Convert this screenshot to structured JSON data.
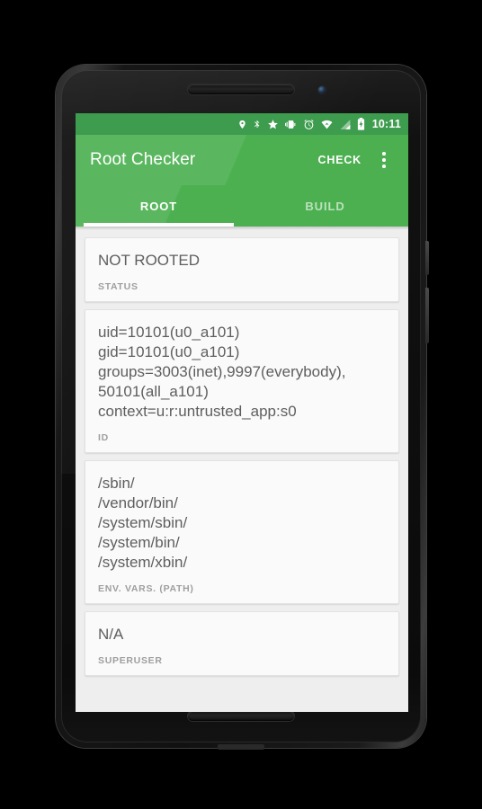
{
  "device": {
    "frame": "android-phone",
    "accent_green": "#4cb050",
    "statusbar_green": "#3d9c4d"
  },
  "statusbar": {
    "icons": [
      "location-icon",
      "bluetooth-icon",
      "star-icon",
      "vibrate-icon",
      "alarm-icon",
      "wifi-icon",
      "signal-icon",
      "battery-charging-icon"
    ],
    "time": "10:11"
  },
  "appbar": {
    "title": "Root Checker",
    "check_label": "CHECK",
    "overflow_label": "More options"
  },
  "tabs": [
    {
      "label": "ROOT",
      "active": true
    },
    {
      "label": "BUILD",
      "active": false
    }
  ],
  "cards": [
    {
      "value": "NOT ROOTED",
      "label": "STATUS"
    },
    {
      "value": "uid=10101(u0_a101)\ngid=10101(u0_a101)\ngroups=3003(inet),9997(everybody),\n50101(all_a101)\ncontext=u:r:untrusted_app:s0",
      "label": "ID"
    },
    {
      "value": "/sbin/\n/vendor/bin/\n/system/sbin/\n/system/bin/\n/system/xbin/",
      "label": "ENV. VARS. (PATH)"
    },
    {
      "value": "N/A",
      "label": "SUPERUSER"
    }
  ]
}
